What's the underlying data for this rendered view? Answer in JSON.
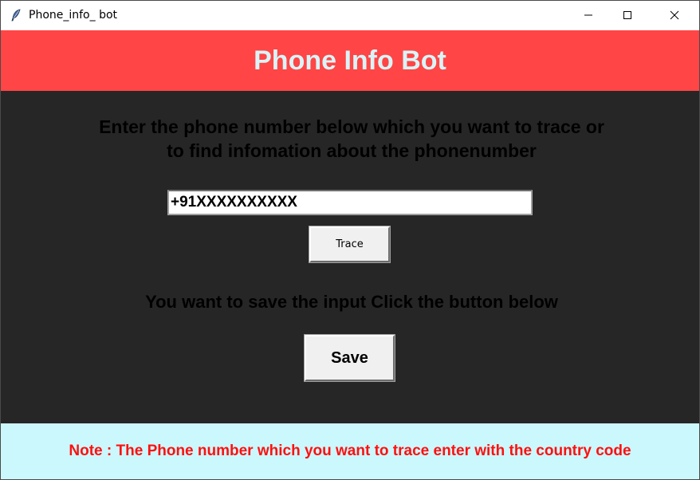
{
  "window": {
    "title": "Phone_info_ bot"
  },
  "header": {
    "title": "Phone Info Bot"
  },
  "main": {
    "instruction_line1": "Enter the phone number below which you want to trace or",
    "instruction_line2": "to find infomation about the phonenumber",
    "phone_input_value": "+91XXXXXXXXXX",
    "trace_label": "Trace",
    "save_prompt": "You want to save the input Click the button below",
    "save_label": "Save"
  },
  "footer": {
    "note": "Note : The Phone number which you want to trace enter with the country code"
  },
  "colors": {
    "header_bg": "#ff4545",
    "header_text": "#d8f4f8",
    "main_bg": "#262626",
    "footer_bg": "#cbf8fc",
    "note_text": "#ff1010"
  },
  "icons": {
    "app": "feather-icon",
    "minimize": "minimize-icon",
    "maximize": "maximize-icon",
    "close": "close-icon"
  }
}
